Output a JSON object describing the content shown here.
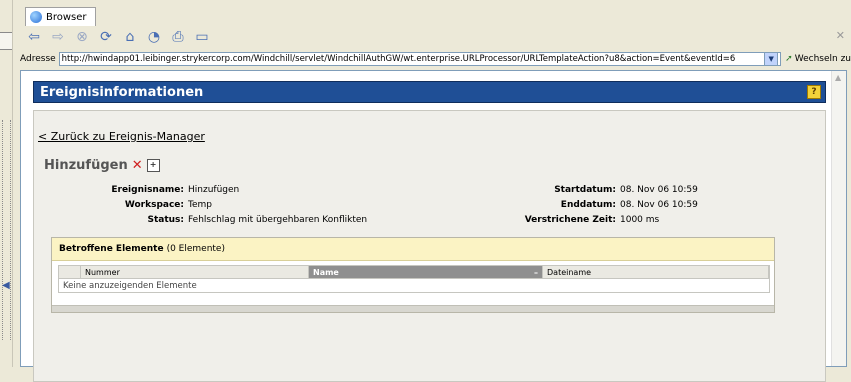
{
  "browser": {
    "tab_label": "Browser",
    "address_label": "Adresse",
    "url": "http://hwindapp01.leibinger.strykercorp.com/Windchill/servlet/WindchillAuthGW/wt.enterprise.URLProcessor/URLTemplateAction?u8&action=Event&eventId=6",
    "go_label": "Wechseln zu",
    "toolbar_icons": [
      "back-arrow-icon",
      "forward-arrow-icon",
      "stop-icon",
      "refresh-icon",
      "home-icon",
      "history-icon",
      "print-icon",
      "save-icon"
    ]
  },
  "page": {
    "title": "Ereignisinformationen",
    "help_label": "?",
    "back_link": "< Zurück zu Ereignis-Manager",
    "heading": "Hinzufügen",
    "fields_left": [
      {
        "key": "Ereignisname:",
        "value": "Hinzufügen"
      },
      {
        "key": "Workspace:",
        "value": "Temp"
      },
      {
        "key": "Status:",
        "value": "Fehlschlag mit übergehbaren Konflikten"
      }
    ],
    "fields_right": [
      {
        "key": "Startdatum:",
        "value": "08. Nov 06 10:59"
      },
      {
        "key": "Enddatum:",
        "value": "08. Nov 06 10:59"
      },
      {
        "key": "Verstrichene Zeit:",
        "value": "1000 ms"
      }
    ],
    "affected": {
      "title": "Betroffene Elemente",
      "count": "(0 Elemente)",
      "columns": [
        "Nummer",
        "Name",
        "Dateiname"
      ],
      "empty_text": "Keine anzuzeigenden Elemente"
    }
  },
  "colors": {
    "titlebar": "#1f4f96",
    "panel_header": "#fbf3c4",
    "delete_icon": "#d02020"
  }
}
